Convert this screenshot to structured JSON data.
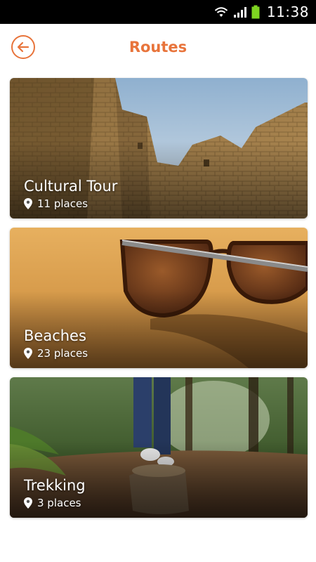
{
  "status_bar": {
    "time": "11:38",
    "icons": [
      "wifi-icon",
      "signal-icon",
      "battery-icon"
    ]
  },
  "header": {
    "title": "Routes",
    "back_icon": "arrow-left-icon"
  },
  "colors": {
    "accent": "#e8743b",
    "status_bar": "#000000",
    "battery": "#7ed321"
  },
  "routes": [
    {
      "title": "Cultural Tour",
      "places": "11 places",
      "icon": "map-pin-icon"
    },
    {
      "title": "Beaches",
      "places": "23 places",
      "icon": "map-pin-icon"
    },
    {
      "title": "Trekking",
      "places": "3 places",
      "icon": "map-pin-icon"
    }
  ]
}
